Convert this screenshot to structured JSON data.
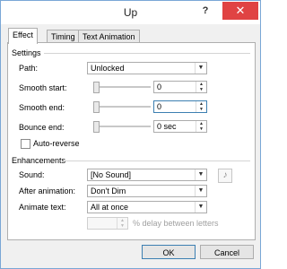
{
  "window": {
    "title": "Up",
    "help": "?",
    "close": "✕"
  },
  "tabs": [
    {
      "label": "Effect",
      "active": true
    },
    {
      "label": "Timing",
      "active": false
    },
    {
      "label": "Text Animation",
      "active": false
    }
  ],
  "settings": {
    "heading": "Settings",
    "path": {
      "label": "Path:",
      "value": "Unlocked"
    },
    "smooth_start": {
      "label": "Smooth start:",
      "value": "0"
    },
    "smooth_end": {
      "label": "Smooth end:",
      "value": "0"
    },
    "bounce_end": {
      "label": "Bounce end:",
      "value": "0 sec"
    },
    "auto_reverse": {
      "label": "Auto-reverse",
      "checked": false
    }
  },
  "enhancements": {
    "heading": "Enhancements",
    "sound": {
      "label": "Sound:",
      "value": "[No Sound]"
    },
    "after_animation": {
      "label": "After animation:",
      "value": "Don't Dim"
    },
    "animate_text": {
      "label": "Animate text:",
      "value": "All at once"
    },
    "delay": {
      "value": "",
      "suffix": "% delay between letters"
    }
  },
  "buttons": {
    "ok": "OK",
    "cancel": "Cancel"
  },
  "colors": {
    "close_bg": "#e04343",
    "border": "#7aa7d6"
  }
}
